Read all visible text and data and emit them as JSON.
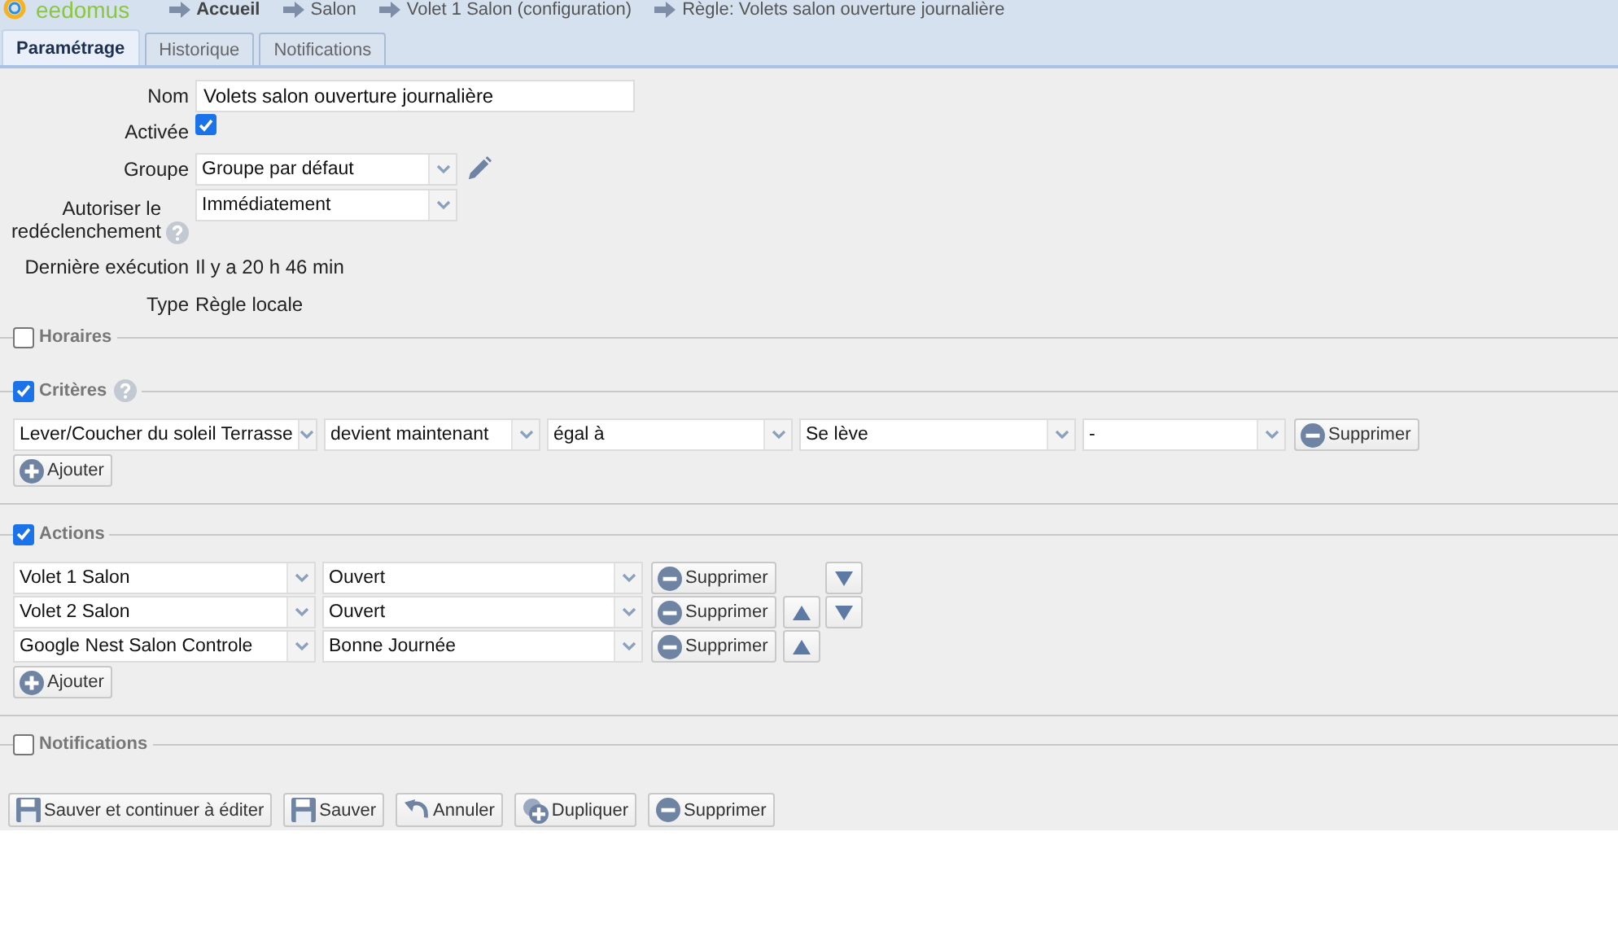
{
  "header": {
    "logo": "eedomus",
    "breadcrumbs": [
      {
        "label": "Accueil",
        "bold": true
      },
      {
        "label": "Salon",
        "bold": false
      },
      {
        "label": "Volet 1 Salon (configuration)",
        "bold": false
      },
      {
        "label": "Règle: Volets salon ouverture journalière",
        "bold": false
      }
    ]
  },
  "tabs": [
    {
      "label": "Paramétrage",
      "selected": true
    },
    {
      "label": "Historique",
      "selected": false
    },
    {
      "label": "Notifications",
      "selected": false
    }
  ],
  "fields": [
    {
      "kind": "text",
      "label": "Nom",
      "value": "Volets salon ouverture journalière"
    },
    {
      "kind": "checkbox",
      "label": "Activée",
      "checked": true
    },
    {
      "kind": "select",
      "label": "Groupe",
      "value": "Groupe par défaut",
      "edit_icon": true
    },
    {
      "kind": "select",
      "label": "Autoriser le redéclenchement",
      "value": "Immédiatement",
      "help": true
    },
    {
      "kind": "info",
      "label": "Dernière exécution",
      "value": "Il y a 20 h 46 min"
    },
    {
      "kind": "info",
      "label": "Type",
      "value": "Règle locale"
    }
  ],
  "sections": [
    {
      "kind": "plain",
      "title": "Horaires",
      "checked": false
    },
    {
      "kind": "criteria",
      "title": "Critères",
      "checked": true,
      "help": true,
      "rows": [
        {
          "selects": [
            "Lever/Coucher du soleil Terrasse",
            "devient maintenant",
            "égal à",
            "Se lève",
            "-"
          ],
          "delete_label": "Supprimer"
        }
      ],
      "add_label": "Ajouter"
    },
    {
      "kind": "actions",
      "title": "Actions",
      "checked": true,
      "rows": [
        {
          "selects": [
            "Volet 1 Salon",
            "Ouvert"
          ],
          "delete_label": "Supprimer",
          "move_up": false,
          "move_down": true
        },
        {
          "selects": [
            "Volet 2 Salon",
            "Ouvert"
          ],
          "delete_label": "Supprimer",
          "move_up": true,
          "move_down": true
        },
        {
          "selects": [
            "Google Nest Salon Controle",
            "Bonne Journée"
          ],
          "delete_label": "Supprimer",
          "move_up": true,
          "move_down": false
        }
      ],
      "add_label": "Ajouter"
    },
    {
      "kind": "plain",
      "title": "Notifications",
      "checked": false
    }
  ],
  "footer_buttons": [
    {
      "kind": "save",
      "label": "Sauver et continuer à éditer"
    },
    {
      "kind": "save",
      "label": "Sauver"
    },
    {
      "kind": "undo",
      "label": "Annuler"
    },
    {
      "kind": "duplicate",
      "label": "Dupliquer"
    },
    {
      "kind": "delete",
      "label": "Supprimer"
    }
  ]
}
